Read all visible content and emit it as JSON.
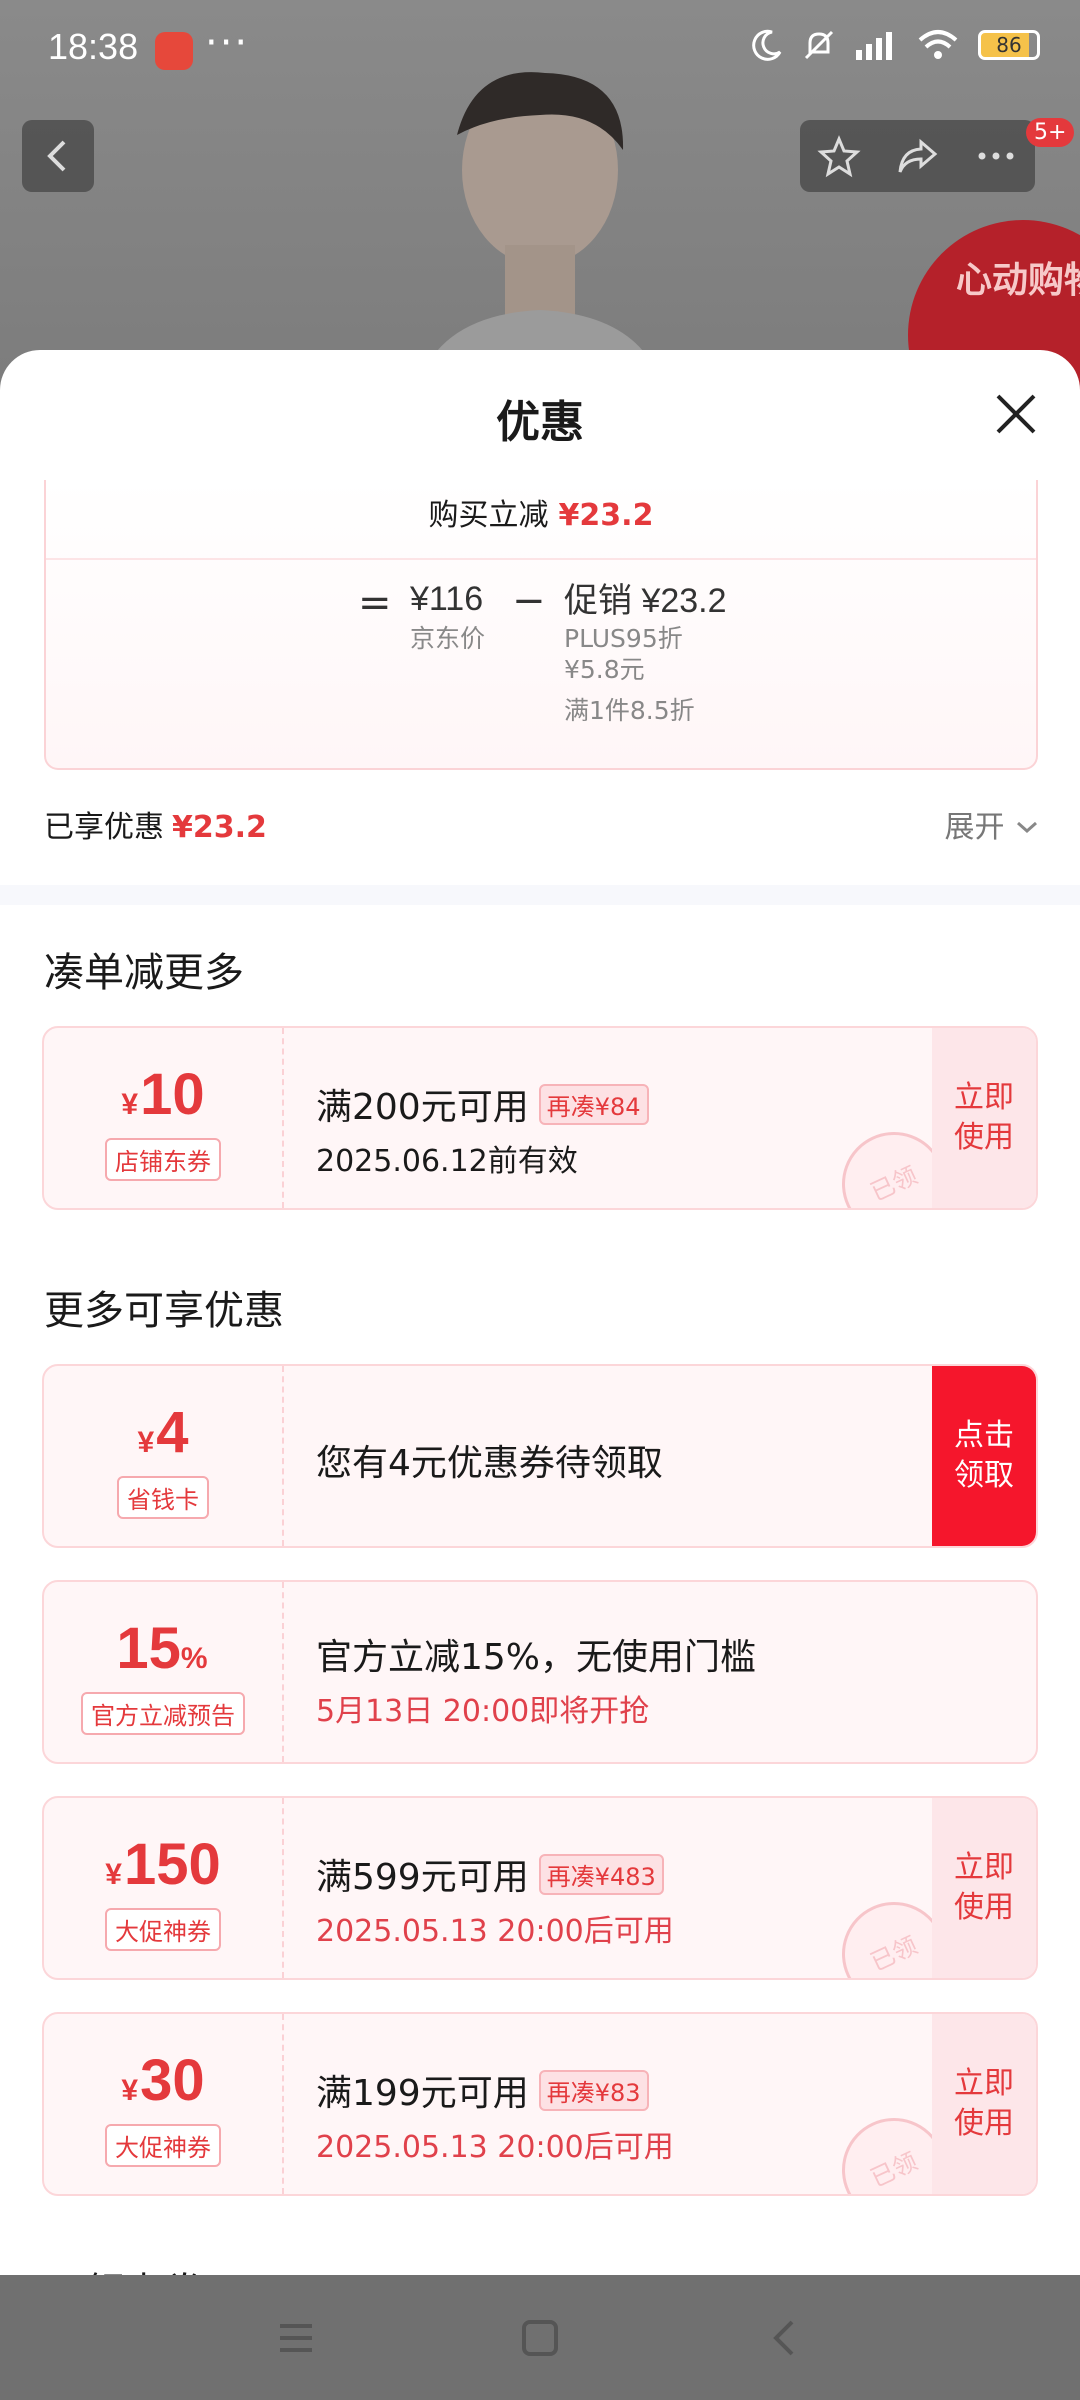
{
  "status": {
    "time": "18:38",
    "battery": "86"
  },
  "background": {
    "badge": "5+",
    "promo_text": "心动购物季"
  },
  "sheet": {
    "title": "优惠",
    "calc": {
      "buy_label": "购买立减",
      "buy_amount": "¥23.2",
      "equals": "=",
      "jd_price": "¥116",
      "jd_price_label": "京东价",
      "minus": "−",
      "promo": "促销 ¥23.2",
      "promo_detail_1": "PLUS95折",
      "promo_detail_2": "¥5.8元",
      "promo_detail_3": "满1件8.5折"
    },
    "enjoyed_label": "已享优惠",
    "enjoyed_amount": "¥23.2",
    "expand_label": "展开",
    "section1_title": "凑单减更多",
    "section2_title": "更多可享优惠",
    "coupons": [
      {
        "currency": "¥",
        "amount": "10",
        "tag": "店铺东券",
        "title": "满200元可用",
        "pill": "再凑¥84",
        "subtitle": "2025.06.12前有效",
        "action": "立即\n使用",
        "stamp": "已领"
      },
      {
        "currency": "¥",
        "amount": "4",
        "tag": "省钱卡",
        "title": "您有4元优惠券待领取",
        "action": "点击\n领取"
      },
      {
        "amount": "15",
        "suffix": "%",
        "tag": "官方立减预告",
        "title": "官方立减15%，无使用门槛",
        "subtitle": "5月13日 20:00即将开抢"
      },
      {
        "currency": "¥",
        "amount": "150",
        "tag": "大促神券",
        "title": "满599元可用",
        "pill": "再凑¥483",
        "subtitle": "2025.05.13 20:00后可用",
        "action": "立即\n使用",
        "stamp": "已领"
      },
      {
        "currency": "¥",
        "amount": "30",
        "tag": "大促神券",
        "title": "满199元可用",
        "pill": "再凑¥83",
        "subtitle": "2025.05.13 20:00后可用",
        "action": "立即\n使用",
        "stamp": "已领"
      }
    ],
    "bottom_peek": "可领点券"
  },
  "icons": [
    "back-icon",
    "star-icon",
    "share-icon",
    "more-icon",
    "close-icon",
    "chevron-down-icon",
    "menu-icon",
    "home-icon",
    "back-nav-icon"
  ]
}
